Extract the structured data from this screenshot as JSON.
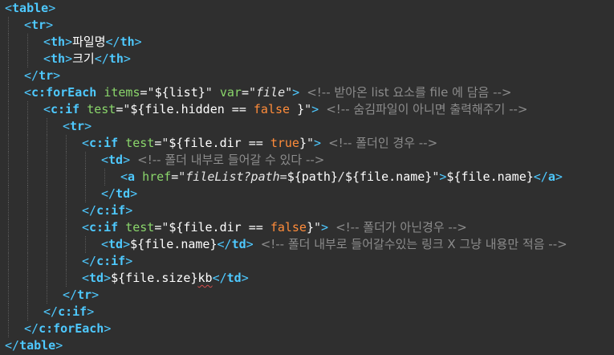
{
  "editor": {
    "lines": [
      {
        "indent": 0,
        "tokens": [
          {
            "t": "bracket",
            "v": "<"
          },
          {
            "t": "tag",
            "v": "table"
          },
          {
            "t": "bracket",
            "v": ">"
          }
        ]
      },
      {
        "indent": 1,
        "tokens": [
          {
            "t": "bracket",
            "v": "<"
          },
          {
            "t": "tag",
            "v": "tr"
          },
          {
            "t": "bracket",
            "v": ">"
          }
        ]
      },
      {
        "indent": 2,
        "tokens": [
          {
            "t": "bracket",
            "v": "<"
          },
          {
            "t": "tag",
            "v": "th"
          },
          {
            "t": "bracket",
            "v": ">"
          },
          {
            "t": "text",
            "v": "파일명",
            "k": true
          },
          {
            "t": "bracket",
            "v": "</"
          },
          {
            "t": "tag",
            "v": "th"
          },
          {
            "t": "bracket",
            "v": ">"
          }
        ]
      },
      {
        "indent": 2,
        "tokens": [
          {
            "t": "bracket",
            "v": "<"
          },
          {
            "t": "tag",
            "v": "th"
          },
          {
            "t": "bracket",
            "v": ">"
          },
          {
            "t": "text",
            "v": "크기",
            "k": true
          },
          {
            "t": "bracket",
            "v": "</"
          },
          {
            "t": "tag",
            "v": "th"
          },
          {
            "t": "bracket",
            "v": ">"
          }
        ]
      },
      {
        "indent": 1,
        "tokens": [
          {
            "t": "bracket",
            "v": "</"
          },
          {
            "t": "tag",
            "v": "tr"
          },
          {
            "t": "bracket",
            "v": ">"
          }
        ]
      },
      {
        "indent": 1,
        "tokens": [
          {
            "t": "bracket",
            "v": "<"
          },
          {
            "t": "tag",
            "v": "c:forEach"
          },
          {
            "t": "text",
            "v": " "
          },
          {
            "t": "attr",
            "v": "items"
          },
          {
            "t": "text",
            "v": "="
          },
          {
            "t": "quote",
            "v": "\""
          },
          {
            "t": "el",
            "v": "${list}"
          },
          {
            "t": "quote",
            "v": "\""
          },
          {
            "t": "text",
            "v": " "
          },
          {
            "t": "attr",
            "v": "var"
          },
          {
            "t": "text",
            "v": "="
          },
          {
            "t": "quote",
            "v": "\"file\""
          },
          {
            "t": "bracket",
            "v": ">"
          },
          {
            "t": "text",
            "v": " "
          },
          {
            "t": "comment",
            "v": "<!-- 받아온 list 요소를 file 에 담음 -->",
            "k": true
          }
        ]
      },
      {
        "indent": 2,
        "tokens": [
          {
            "t": "bracket",
            "v": "<"
          },
          {
            "t": "tag",
            "v": "c:if"
          },
          {
            "t": "text",
            "v": " "
          },
          {
            "t": "attr",
            "v": "test"
          },
          {
            "t": "text",
            "v": "="
          },
          {
            "t": "quote",
            "v": "\""
          },
          {
            "t": "el",
            "v": "${file.hidden == "
          },
          {
            "t": "keyword",
            "v": "false"
          },
          {
            "t": "el",
            "v": " }"
          },
          {
            "t": "quote",
            "v": "\""
          },
          {
            "t": "bracket",
            "v": ">"
          },
          {
            "t": "text",
            "v": " "
          },
          {
            "t": "comment",
            "v": "<!-- 숨김파일이 아니면 출력해주기 -->",
            "k": true
          }
        ]
      },
      {
        "indent": 3,
        "tokens": [
          {
            "t": "bracket",
            "v": "<"
          },
          {
            "t": "tag",
            "v": "tr"
          },
          {
            "t": "bracket",
            "v": ">"
          }
        ]
      },
      {
        "indent": 4,
        "tokens": [
          {
            "t": "bracket",
            "v": "<"
          },
          {
            "t": "tag",
            "v": "c:if"
          },
          {
            "t": "text",
            "v": " "
          },
          {
            "t": "attr",
            "v": "test"
          },
          {
            "t": "text",
            "v": "="
          },
          {
            "t": "quote",
            "v": "\""
          },
          {
            "t": "el",
            "v": "${file.dir == "
          },
          {
            "t": "keyword",
            "v": "true"
          },
          {
            "t": "el",
            "v": "}"
          },
          {
            "t": "quote",
            "v": "\""
          },
          {
            "t": "bracket",
            "v": ">"
          },
          {
            "t": "text",
            "v": " "
          },
          {
            "t": "comment",
            "v": "<!-- 폴더인 경우 -->",
            "k": true
          }
        ]
      },
      {
        "indent": 5,
        "tokens": [
          {
            "t": "bracket",
            "v": "<"
          },
          {
            "t": "tag",
            "v": "td"
          },
          {
            "t": "bracket",
            "v": ">"
          },
          {
            "t": "text",
            "v": " "
          },
          {
            "t": "comment",
            "v": "<!-- 폴더 내부로 들어갈 수 있다 -->",
            "k": true
          }
        ]
      },
      {
        "indent": 6,
        "tokens": [
          {
            "t": "bracket",
            "v": "<"
          },
          {
            "t": "tag",
            "v": "a"
          },
          {
            "t": "text",
            "v": " "
          },
          {
            "t": "attr",
            "v": "href"
          },
          {
            "t": "text",
            "v": "="
          },
          {
            "t": "quote",
            "v": "\"fileList?path="
          },
          {
            "t": "el",
            "v": "${path}"
          },
          {
            "t": "quote",
            "v": "/"
          },
          {
            "t": "el",
            "v": "${file.name}"
          },
          {
            "t": "quote",
            "v": "\""
          },
          {
            "t": "bracket",
            "v": ">"
          },
          {
            "t": "el",
            "v": "${file.name}"
          },
          {
            "t": "bracket",
            "v": "</"
          },
          {
            "t": "tag",
            "v": "a"
          },
          {
            "t": "bracket",
            "v": ">"
          }
        ]
      },
      {
        "indent": 5,
        "tokens": [
          {
            "t": "bracket",
            "v": "</"
          },
          {
            "t": "tag",
            "v": "td"
          },
          {
            "t": "bracket",
            "v": ">"
          }
        ]
      },
      {
        "indent": 4,
        "tokens": [
          {
            "t": "bracket",
            "v": "</"
          },
          {
            "t": "tag",
            "v": "c:if"
          },
          {
            "t": "bracket",
            "v": ">"
          }
        ]
      },
      {
        "indent": 4,
        "tokens": [
          {
            "t": "bracket",
            "v": "<"
          },
          {
            "t": "tag",
            "v": "c:if"
          },
          {
            "t": "text",
            "v": " "
          },
          {
            "t": "attr",
            "v": "test"
          },
          {
            "t": "text",
            "v": "="
          },
          {
            "t": "quote",
            "v": "\""
          },
          {
            "t": "el",
            "v": "${file.dir == "
          },
          {
            "t": "keyword",
            "v": "false"
          },
          {
            "t": "el",
            "v": "}"
          },
          {
            "t": "quote",
            "v": "\""
          },
          {
            "t": "bracket",
            "v": ">"
          },
          {
            "t": "text",
            "v": " "
          },
          {
            "t": "comment",
            "v": "<!-- 폴더가 아닌경우 -->",
            "k": true
          }
        ]
      },
      {
        "indent": 5,
        "tokens": [
          {
            "t": "bracket",
            "v": "<"
          },
          {
            "t": "tag",
            "v": "td"
          },
          {
            "t": "bracket",
            "v": ">"
          },
          {
            "t": "el",
            "v": "${file.name}"
          },
          {
            "t": "bracket",
            "v": "</"
          },
          {
            "t": "tag",
            "v": "td"
          },
          {
            "t": "bracket",
            "v": ">"
          },
          {
            "t": "text",
            "v": " "
          },
          {
            "t": "comment",
            "v": "<!-- 폴더 내부로 들어갈수있는 링크 X 그냥 내용만 적음 -->",
            "k": true
          }
        ]
      },
      {
        "indent": 4,
        "tokens": [
          {
            "t": "bracket",
            "v": "</"
          },
          {
            "t": "tag",
            "v": "c:if"
          },
          {
            "t": "bracket",
            "v": ">"
          }
        ]
      },
      {
        "indent": 4,
        "tokens": [
          {
            "t": "bracket",
            "v": "<"
          },
          {
            "t": "tag",
            "v": "td"
          },
          {
            "t": "bracket",
            "v": ">"
          },
          {
            "t": "el",
            "v": "${file.size}"
          },
          {
            "t": "text",
            "v": "kb",
            "sq": true
          },
          {
            "t": "bracket",
            "v": "</"
          },
          {
            "t": "tag",
            "v": "td"
          },
          {
            "t": "bracket",
            "v": ">"
          }
        ]
      },
      {
        "indent": 3,
        "tokens": [
          {
            "t": "bracket",
            "v": "</"
          },
          {
            "t": "tag",
            "v": "tr"
          },
          {
            "t": "bracket",
            "v": ">"
          }
        ]
      },
      {
        "indent": 2,
        "tokens": [
          {
            "t": "bracket",
            "v": "</"
          },
          {
            "t": "tag",
            "v": "c:if"
          },
          {
            "t": "bracket",
            "v": ">"
          }
        ]
      },
      {
        "indent": 1,
        "tokens": [
          {
            "t": "bracket",
            "v": "</"
          },
          {
            "t": "tag",
            "v": "c:forEach"
          },
          {
            "t": "bracket",
            "v": ">"
          }
        ]
      },
      {
        "indent": 0,
        "tokens": [
          {
            "t": "bracket",
            "v": "</"
          },
          {
            "t": "tag",
            "v": "table"
          },
          {
            "t": "bracket",
            "v": ">"
          }
        ]
      }
    ]
  },
  "colors": {
    "background": "#2f2f2f",
    "tag": "#4ec9ff",
    "attribute": "#8ad66b",
    "keyword": "#ff8c3a",
    "comment": "#8c8c8c",
    "text": "#ffffff"
  }
}
